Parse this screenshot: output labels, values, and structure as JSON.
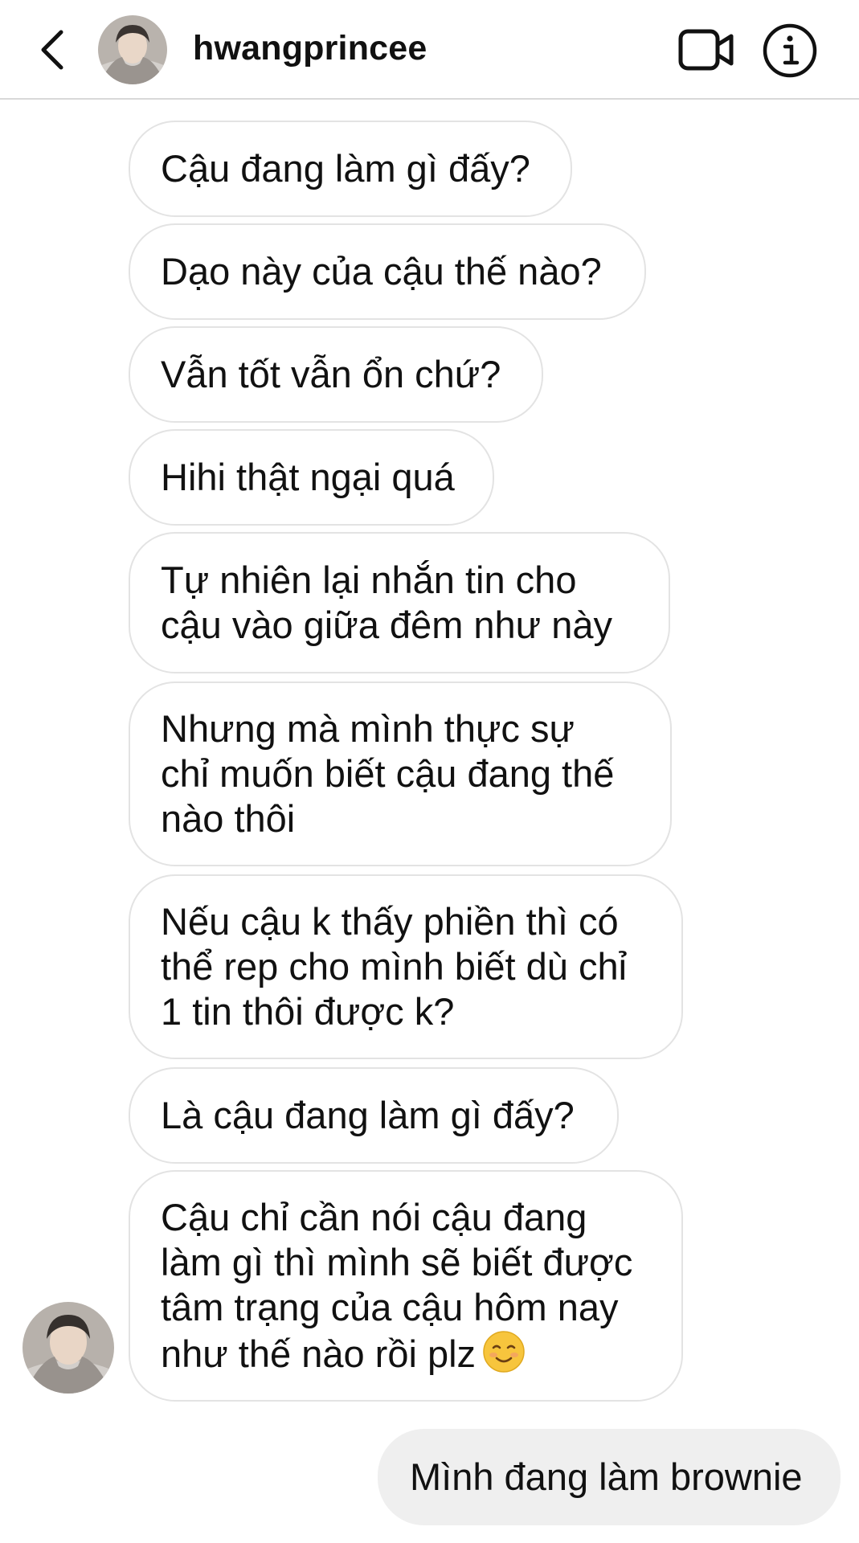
{
  "header": {
    "username": "hwangprincee",
    "icons": {
      "back": "chevron-left-icon",
      "video": "video-camera-icon",
      "info": "info-icon"
    }
  },
  "messages": [
    {
      "from": "them",
      "text": "Cậu đang làm gì đấy?"
    },
    {
      "from": "them",
      "text": "Dạo này của cậu thế nào?"
    },
    {
      "from": "them",
      "text": "Vẫn tốt vẫn ổn chứ?"
    },
    {
      "from": "them",
      "text": "Hihi thật ngại quá"
    },
    {
      "from": "them",
      "text": "Tự nhiên lại nhắn tin cho\ncậu vào giữa đêm như này"
    },
    {
      "from": "them",
      "text": "Nhưng mà mình thực sự\nchỉ muốn biết cậu đang thế\nnào thôi"
    },
    {
      "from": "them",
      "text": "Nếu cậu k thấy phiền thì có\nthể rep cho mình biết dù chỉ\n1 tin thôi được k?"
    },
    {
      "from": "them",
      "text": "Là cậu đang làm gì đấy?"
    },
    {
      "from": "them",
      "text": "Cậu chỉ cần nói cậu đang\nlàm gì thì mình sẽ biết được\ntâm trạng của cậu hôm nay\nnhư thế nào rồi plz",
      "emoji": "smiling-face-emoji"
    },
    {
      "from": "me",
      "text": "Mình đang làm brownie"
    }
  ],
  "colors": {
    "bubble_border": "#e3e3e3",
    "sent_bubble": "#efefef",
    "divider": "#d9d9d9"
  }
}
